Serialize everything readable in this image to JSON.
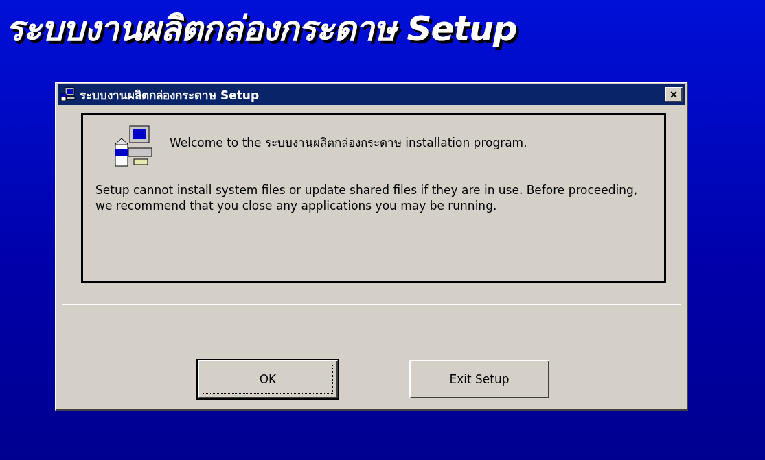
{
  "banner": {
    "title": "ระบบงานผลิตกล่องกระดาษ Setup"
  },
  "window": {
    "title": "ระบบงานผลิตกล่องกระดาษ Setup",
    "close": "×"
  },
  "welcome": "Welcome to the ระบบงานผลิตกล่องกระดาษ installation program.",
  "message": "Setup cannot install system files or update shared files if they are in use. Before proceeding, we recommend that you close any applications you may be running.",
  "buttons": [
    {
      "label": "OK",
      "default": true
    },
    {
      "label": "Exit Setup",
      "default": false
    }
  ]
}
